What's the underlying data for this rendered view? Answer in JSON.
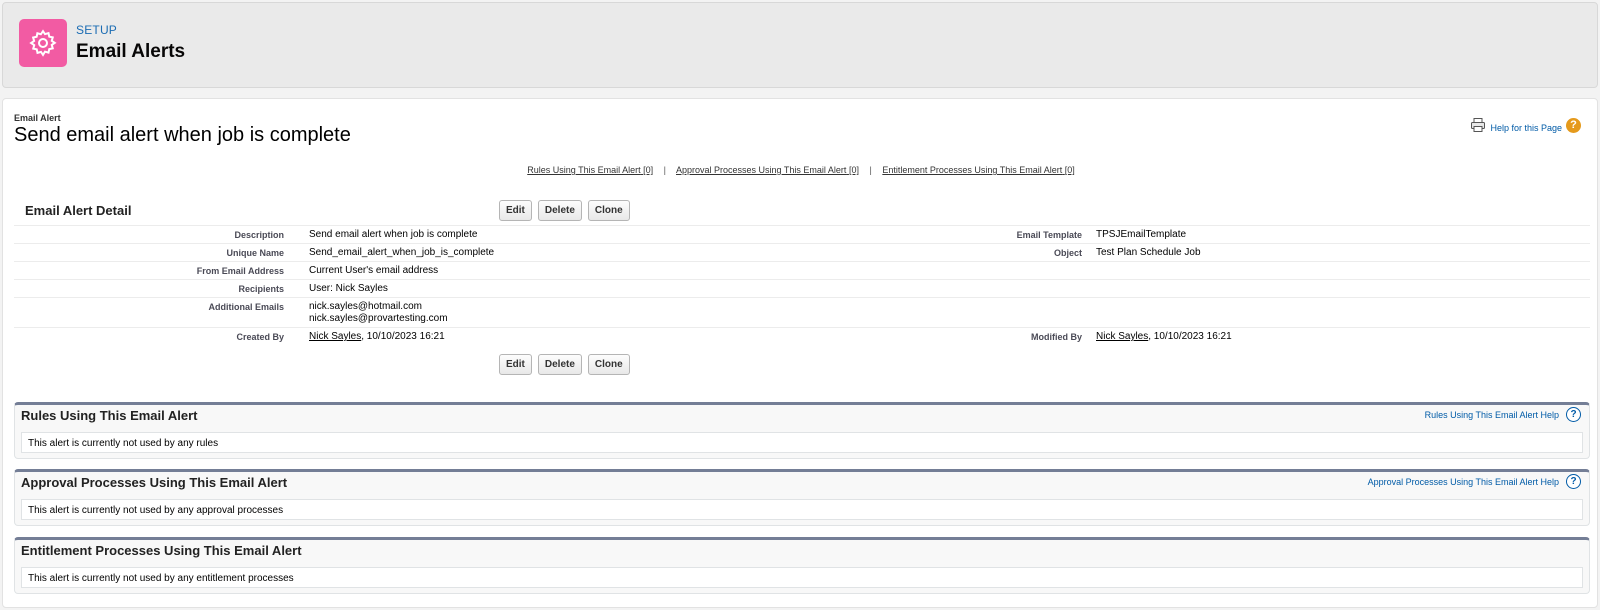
{
  "header": {
    "kicker": "SETUP",
    "title": "Email Alerts",
    "icon": "gear-icon",
    "icon_bg": "#f25ba3"
  },
  "page": {
    "type_label": "Email Alert",
    "title": "Send email alert when job is complete",
    "help_link": "Help for this Page"
  },
  "related_links": [
    {
      "label": "Rules Using This Email Alert",
      "count": "[0]"
    },
    {
      "label": "Approval Processes Using This Email Alert",
      "count": "[0]"
    },
    {
      "label": "Entitlement Processes Using This Email Alert",
      "count": "[0]"
    }
  ],
  "detail": {
    "title": "Email Alert Detail",
    "buttons": {
      "edit": "Edit",
      "delete": "Delete",
      "clone": "Clone"
    },
    "fields": {
      "description": {
        "label": "Description",
        "value": "Send email alert when job is complete"
      },
      "unique_name": {
        "label": "Unique Name",
        "value": "Send_email_alert_when_job_is_complete"
      },
      "from_email": {
        "label": "From Email Address",
        "value": "Current User's email address"
      },
      "recipients": {
        "label": "Recipients",
        "value": "User: Nick Sayles"
      },
      "additional_emails": {
        "label": "Additional Emails",
        "value1": "nick.sayles@hotmail.com",
        "value2": "nick.sayles@provartesting.com"
      },
      "created_by": {
        "label": "Created By",
        "user": "Nick Sayles",
        "date": ", 10/10/2023 16:21"
      },
      "email_template": {
        "label": "Email Template",
        "value": "TPSJEmailTemplate"
      },
      "object": {
        "label": "Object",
        "value": "Test Plan Schedule Job"
      },
      "modified_by": {
        "label": "Modified By",
        "user": "Nick Sayles",
        "date": ", 10/10/2023 16:21"
      }
    }
  },
  "sections": {
    "rules": {
      "title": "Rules Using This Email Alert",
      "help": "Rules Using This Email Alert Help",
      "body": "This alert is currently not used by any rules"
    },
    "approval": {
      "title": "Approval Processes Using This Email Alert",
      "help": "Approval Processes Using This Email Alert Help",
      "body": "This alert is currently not used by any approval processes"
    },
    "entitlement": {
      "title": "Entitlement Processes Using This Email Alert",
      "body": "This alert is currently not used by any entitlement processes"
    }
  },
  "colors": {
    "accent_link": "#015ba7",
    "section_bar": "#747e96",
    "help_orange": "#e59a1c"
  }
}
